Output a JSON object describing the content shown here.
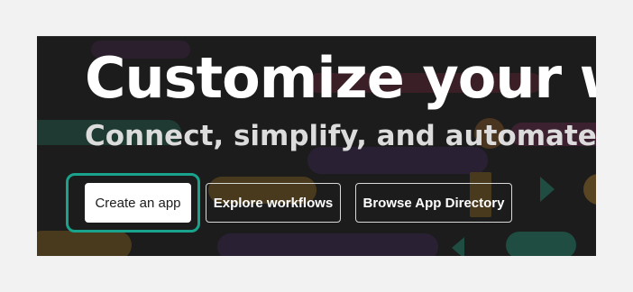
{
  "hero": {
    "headline": "Customize your wor",
    "subheadline": "Connect, simplify, and automate yo",
    "background_color": "#1c1c1c",
    "accent_focus_color": "#1aa38c"
  },
  "actions": {
    "create_app_label": "Create an app",
    "explore_workflows_label": "Explore workflows",
    "browse_directory_label": "Browse App Directory"
  }
}
